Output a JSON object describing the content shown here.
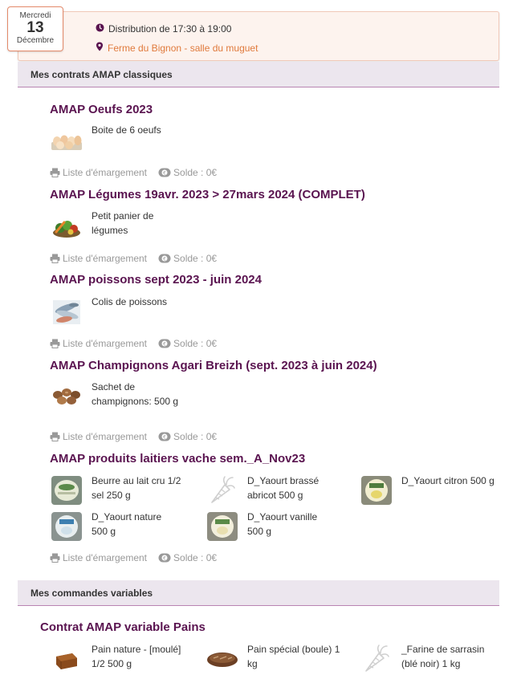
{
  "date": {
    "day_of_week": "Mercredi",
    "day": "13",
    "month": "Décembre"
  },
  "distribution": {
    "time": "Distribution de 17:30 à 19:00",
    "place": "Ferme du Bignon - salle du muguet"
  },
  "sections": {
    "classic_title": "Mes contrats AMAP classiques",
    "variable_title": "Mes commandes variables"
  },
  "footer": {
    "attendance_label": "Liste d'émargement",
    "balance_label": "Solde : 0€"
  },
  "contracts": [
    {
      "title": "AMAP Oeufs 2023",
      "products": [
        {
          "name": "Boite de 6 oeufs",
          "icon": "eggs-image"
        }
      ]
    },
    {
      "title": "AMAP Légumes 19avr. 2023 > 27mars 2024 (COMPLET)",
      "products": [
        {
          "name": "Petit panier de légumes",
          "icon": "vegetables-image"
        }
      ]
    },
    {
      "title": "AMAP poissons sept 2023 - juin 2024",
      "products": [
        {
          "name": "Colis de poissons",
          "icon": "fish-image"
        }
      ]
    },
    {
      "title": "AMAP Champignons Agari Breizh (sept. 2023 à juin 2024)",
      "products": [
        {
          "name": "Sachet de champignons: 500 g",
          "icon": "mushrooms-image"
        }
      ]
    },
    {
      "title": "AMAP produits laitiers vache sem._A_Nov23",
      "products": [
        {
          "name": "Beurre au lait cru 1/2 sel 250 g",
          "icon": "butter-image"
        },
        {
          "name": "D_Yaourt brassé abricot 500 g",
          "icon": "carrot-placeholder-icon"
        },
        {
          "name": "D_Yaourt citron 500 g",
          "icon": "yogurt-lemon-image"
        },
        {
          "name": "D_Yaourt nature 500 g",
          "icon": "yogurt-nature-image"
        },
        {
          "name": "D_Yaourt vanille 500 g",
          "icon": "yogurt-vanilla-image"
        }
      ]
    }
  ],
  "variable_contracts": [
    {
      "title": "Contrat AMAP variable Pains",
      "products": [
        {
          "name": "Pain nature - [moulé] 1/2 500 g",
          "icon": "bread-loaf-image"
        },
        {
          "name": "Pain spécial (boule) 1 kg",
          "icon": "bread-boule-image"
        },
        {
          "name": "_Farine de sarrasin (blé noir) 1 kg",
          "icon": "carrot-placeholder-icon"
        }
      ]
    }
  ],
  "colors": {
    "title": "#5a1450",
    "place": "#e07a3c",
    "section_bg": "#ece6ee",
    "muted": "#999999"
  }
}
